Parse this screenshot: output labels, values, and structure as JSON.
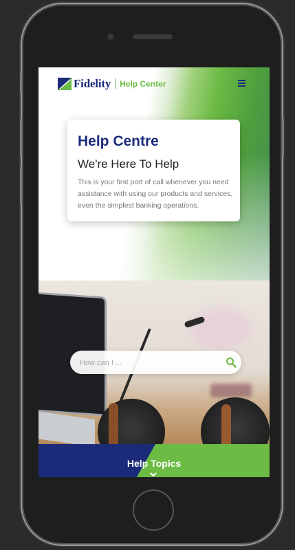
{
  "header": {
    "logo_text": "Fidelity",
    "logo_subtext": "Help Center",
    "menu_icon": "hamburger-menu-icon"
  },
  "hero": {
    "title": "Help Centre",
    "subtitle": "We're Here To Help",
    "description": "This is your first port of call whenever you need assistance with using our products and services, even the simplest banking operations."
  },
  "search": {
    "placeholder": "How can I ...",
    "icon": "search-icon"
  },
  "topics": {
    "label": "Help Topics",
    "icon": "chevron-down-icon"
  },
  "colors": {
    "brand_blue": "#1b2b7a",
    "brand_green": "#6cbb45"
  }
}
